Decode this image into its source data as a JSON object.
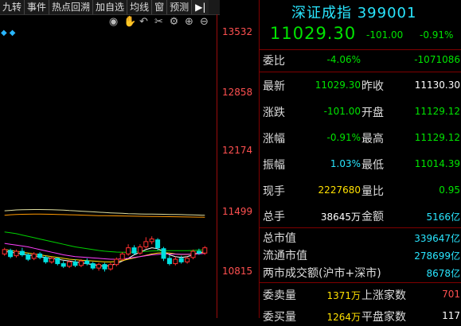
{
  "toolbar": {
    "items": [
      "九转",
      "事件",
      "热点回溯",
      "加自选",
      "均线",
      "窗",
      "预测"
    ],
    "end_icon": "▶|"
  },
  "chart_icons": [
    "eye-icon",
    "hand-icon",
    "undo-icon",
    "scissors-icon",
    "gear-icon",
    "zoom-in-icon",
    "zoom-out-icon"
  ],
  "y_axis": {
    "labels": [
      "13532",
      "12858",
      "12174",
      "11499",
      "10815"
    ]
  },
  "chart_data": {
    "type": "candlestick",
    "ylim": [
      10700,
      13600
    ],
    "candles": [
      {
        "o": 11010,
        "c": 11060,
        "h": 11080,
        "l": 10990
      },
      {
        "o": 11050,
        "c": 10980,
        "h": 11070,
        "l": 10960
      },
      {
        "o": 10990,
        "c": 11040,
        "h": 11060,
        "l": 10970
      },
      {
        "o": 11040,
        "c": 11000,
        "h": 11080,
        "l": 10980
      },
      {
        "o": 11000,
        "c": 10950,
        "h": 11020,
        "l": 10930
      },
      {
        "o": 10960,
        "c": 11010,
        "h": 11030,
        "l": 10940
      },
      {
        "o": 11010,
        "c": 10970,
        "h": 11030,
        "l": 10950
      },
      {
        "o": 10970,
        "c": 10920,
        "h": 10990,
        "l": 10900
      },
      {
        "o": 10920,
        "c": 10960,
        "h": 10980,
        "l": 10900
      },
      {
        "o": 10960,
        "c": 10900,
        "h": 10970,
        "l": 10880
      },
      {
        "o": 10900,
        "c": 10870,
        "h": 10930,
        "l": 10850
      },
      {
        "o": 10870,
        "c": 10920,
        "h": 10940,
        "l": 10850
      },
      {
        "o": 10920,
        "c": 10880,
        "h": 10950,
        "l": 10860
      },
      {
        "o": 10880,
        "c": 10930,
        "h": 10950,
        "l": 10860
      },
      {
        "o": 10930,
        "c": 10900,
        "h": 10960,
        "l": 10880
      },
      {
        "o": 10900,
        "c": 10850,
        "h": 10920,
        "l": 10830
      },
      {
        "o": 10850,
        "c": 10890,
        "h": 10910,
        "l": 10820
      },
      {
        "o": 10890,
        "c": 10840,
        "h": 10910,
        "l": 10810
      },
      {
        "o": 10840,
        "c": 10890,
        "h": 10910,
        "l": 10820
      },
      {
        "o": 10890,
        "c": 10950,
        "h": 10970,
        "l": 10870
      },
      {
        "o": 10950,
        "c": 11010,
        "h": 11030,
        "l": 10930
      },
      {
        "o": 11010,
        "c": 11080,
        "h": 11120,
        "l": 10990
      },
      {
        "o": 11080,
        "c": 11020,
        "h": 11110,
        "l": 11000
      },
      {
        "o": 11020,
        "c": 11090,
        "h": 11120,
        "l": 11000
      },
      {
        "o": 11090,
        "c": 11150,
        "h": 11200,
        "l": 11070
      },
      {
        "o": 11150,
        "c": 11180,
        "h": 11210,
        "l": 11120
      },
      {
        "o": 11170,
        "c": 11080,
        "h": 11190,
        "l": 11050
      },
      {
        "o": 11070,
        "c": 10960,
        "h": 11090,
        "l": 10930
      },
      {
        "o": 10960,
        "c": 10900,
        "h": 10990,
        "l": 10880
      },
      {
        "o": 10900,
        "c": 10950,
        "h": 10980,
        "l": 10880
      },
      {
        "o": 10960,
        "c": 10920,
        "h": 10990,
        "l": 10900
      },
      {
        "o": 10920,
        "c": 10960,
        "h": 10980,
        "l": 10900
      },
      {
        "o": 10970,
        "c": 11040,
        "h": 11060,
        "l": 10950
      },
      {
        "o": 11040,
        "c": 11020,
        "h": 11070,
        "l": 11000
      },
      {
        "o": 11020,
        "c": 11080,
        "h": 11100,
        "l": 11000
      }
    ],
    "ma_lines": [
      {
        "color": "#ffffff",
        "values": [
          11040,
          11030,
          11020,
          11010,
          11000,
          10990,
          10980,
          10970,
          10960,
          10950,
          10940,
          10930,
          10920,
          10910,
          10900,
          10890,
          10880,
          10870,
          10880,
          10900,
          10930,
          10960,
          11000,
          11030,
          11060,
          11080,
          11070,
          11040,
          11000,
          10980,
          10970,
          10980,
          11000,
          11020,
          11040
        ]
      },
      {
        "color": "#ffe000",
        "values": [
          11060,
          11050,
          11040,
          11030,
          11020,
          11010,
          11000,
          10990,
          10980,
          10970,
          10960,
          10950,
          10945,
          10940,
          10935,
          10930,
          10925,
          10920,
          10920,
          10925,
          10935,
          10950,
          10965,
          10980,
          10995,
          11010,
          11020,
          11025,
          11020,
          11010,
          11005,
          11005,
          11010,
          11020,
          11030
        ]
      },
      {
        "color": "#ff40ff",
        "values": [
          11130,
          11120,
          11110,
          11100,
          11090,
          11075,
          11060,
          11045,
          11030,
          11015,
          11000,
          10990,
          10980,
          10975,
          10970,
          10965,
          10960,
          10955,
          10950,
          10950,
          10955,
          10960,
          10970,
          10980,
          10990,
          11000,
          11005,
          11010,
          11010,
          11008,
          11006,
          11006,
          11008,
          11012,
          11016
        ]
      },
      {
        "color": "#00d000",
        "values": [
          11260,
          11250,
          11240,
          11225,
          11210,
          11195,
          11180,
          11165,
          11150,
          11135,
          11120,
          11105,
          11090,
          11080,
          11070,
          11060,
          11050,
          11042,
          11036,
          11032,
          11030,
          11030,
          11032,
          11036,
          11040,
          11044,
          11046,
          11048,
          11048,
          11048,
          11048,
          11048,
          11050,
          11054,
          11058
        ]
      },
      {
        "color": "#e0e0a0",
        "values": [
          11500,
          11505,
          11510,
          11512,
          11514,
          11515,
          11515,
          11514,
          11512,
          11510,
          11507,
          11503,
          11500,
          11496,
          11492,
          11488,
          11484,
          11480,
          11477,
          11474,
          11471,
          11468,
          11466,
          11464,
          11463,
          11462,
          11461,
          11460,
          11459,
          11458,
          11457,
          11455,
          11453,
          11451,
          11449
        ]
      },
      {
        "color": "#ff9900",
        "values": [
          11450,
          11455,
          11458,
          11460,
          11461,
          11462,
          11462,
          11461,
          11460,
          11459,
          11457,
          11455,
          11453,
          11451,
          11449,
          11447,
          11445,
          11444,
          11443,
          11442,
          11441,
          11440,
          11439,
          11438,
          11437,
          11436,
          11435,
          11434,
          11433,
          11432,
          11431,
          11430,
          11429,
          11428,
          11427
        ]
      }
    ]
  },
  "quote": {
    "title": "深证成指 399001",
    "price": "11029.30",
    "change": "-101.00",
    "pct": "-0.91%",
    "weibi_label": "委比",
    "weibi_pct": "-4.06%",
    "weibi_val": "-1071086",
    "rows": [
      {
        "l1": "最新",
        "v1": "11029.30",
        "c1": "g",
        "l2": "昨收",
        "v2": "11130.30",
        "c2": "w"
      },
      {
        "l1": "涨跌",
        "v1": "-101.00",
        "c1": "g",
        "l2": "开盘",
        "v2": "11129.12",
        "c2": "g"
      },
      {
        "l1": "涨幅",
        "v1": "-0.91%",
        "c1": "g",
        "l2": "最高",
        "v2": "11129.12",
        "c2": "g"
      },
      {
        "l1": "振幅",
        "v1": "1.03%",
        "c1": "c",
        "l2": "最低",
        "v2": "11014.39",
        "c2": "g"
      },
      {
        "l1": "现手",
        "v1": "2227680",
        "c1": "y",
        "l2": "量比",
        "v2": "0.95",
        "c2": "g"
      },
      {
        "l1": "总手",
        "v1": "38645万",
        "c1": "w",
        "l2": "金额",
        "v2": "5166亿",
        "c2": "c"
      }
    ],
    "market": [
      {
        "label": "总市值",
        "value": "339647亿"
      },
      {
        "label": "流通市值",
        "value": "278699亿"
      },
      {
        "label": "两市成交额(沪市+深市)",
        "value": "8678亿"
      }
    ],
    "bottom": [
      {
        "l1": "委卖量",
        "v1": "1371万",
        "l2": "上涨家数",
        "v2": "701"
      },
      {
        "l1": "委买量",
        "v1": "1264万",
        "l2": "平盘家数",
        "v2": "117"
      }
    ]
  }
}
